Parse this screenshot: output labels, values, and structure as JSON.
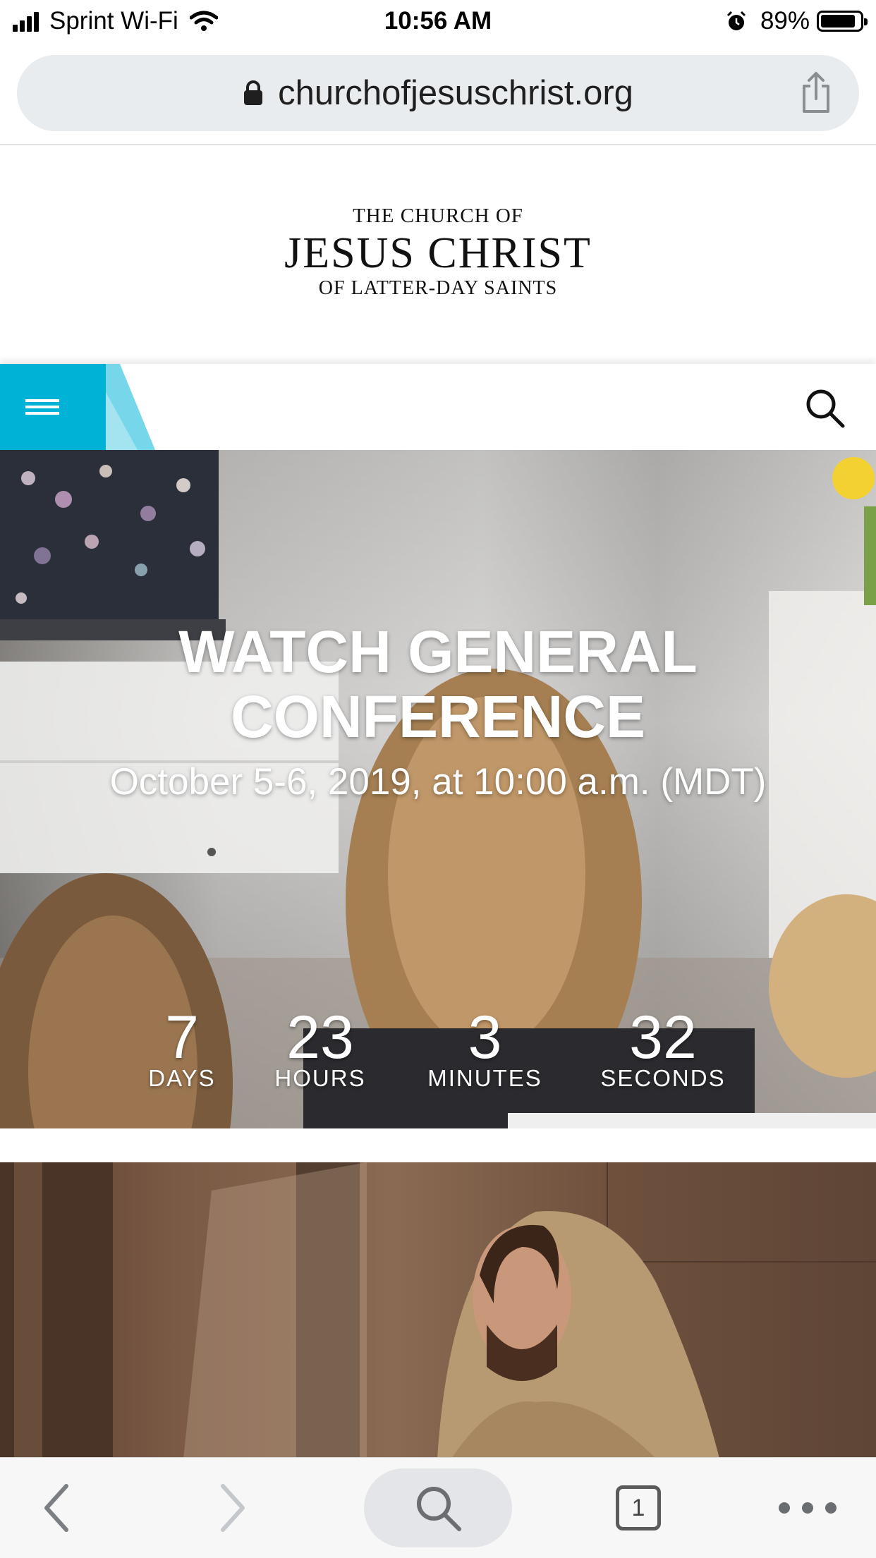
{
  "status_bar": {
    "carrier": "Sprint Wi-Fi",
    "time": "10:56 AM",
    "battery_percent": "89%",
    "battery_level": 0.89,
    "icons": [
      "signal-icon",
      "wifi-icon",
      "alarm-icon",
      "battery-icon"
    ]
  },
  "browser": {
    "url": "churchofjesuschrist.org",
    "icons": [
      "lock-icon",
      "share-icon"
    ]
  },
  "logo": {
    "line1": "THE CHURCH OF",
    "line2": "JESUS CHRIST",
    "line3": "OF LATTER-DAY SAINTS"
  },
  "nav": {
    "icons": [
      "menu-icon",
      "search-icon"
    ],
    "accent_color": "#00b2d6"
  },
  "hero": {
    "title_line1": "WATCH GENERAL",
    "title_line2": "CONFERENCE",
    "date": "October 5-6, 2019, at 10:00 a.m. (MDT)",
    "countdown": [
      {
        "value": "7",
        "label": "DAYS"
      },
      {
        "value": "23",
        "label": "HOURS"
      },
      {
        "value": "3",
        "label": "MINUTES"
      },
      {
        "value": "32",
        "label": "SECONDS"
      }
    ]
  },
  "toolbar": {
    "tab_count": "1",
    "icons": [
      "back-icon",
      "forward-icon",
      "search-icon",
      "tabs-icon",
      "more-icon"
    ]
  }
}
